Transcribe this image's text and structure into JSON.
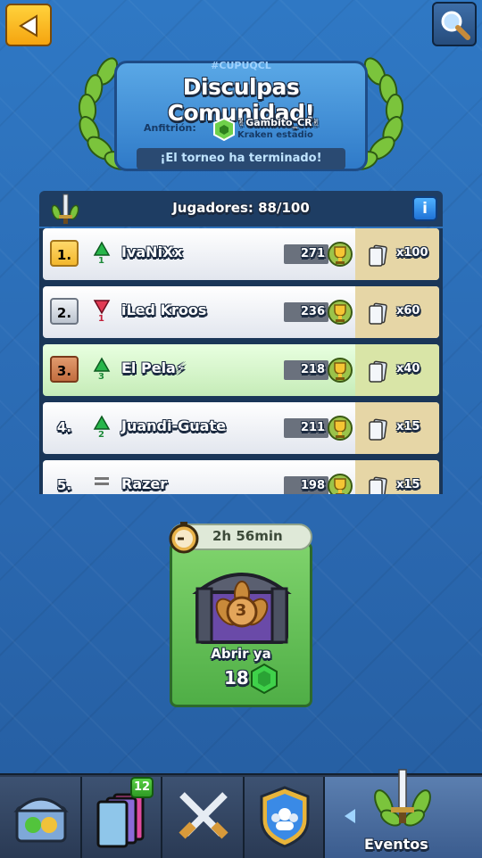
{
  "top": {
    "back_icon": "back-arrow-icon",
    "search_icon": "magnifier-icon"
  },
  "tournament": {
    "tag": "#CUPUQCL",
    "title": "Disculpas Comunidad!",
    "host_label": "Anfitrión:",
    "host_name": "✌Gambito_CR✌",
    "host_clan": "Kraken estadio",
    "status": "¡El torneo ha terminado!"
  },
  "players_panel": {
    "count_label": "Jugadores: 88/100",
    "info_label": "i",
    "rows": [
      {
        "rank": "1.",
        "medal": "gold",
        "trend": "up",
        "trend_num": "1",
        "name": "IvaNiXx",
        "score": "271",
        "reward": "x100",
        "highlight": false
      },
      {
        "rank": "2.",
        "medal": "silver",
        "trend": "down",
        "trend_num": "1",
        "name": "iLed Kroos",
        "score": "236",
        "reward": "x60",
        "highlight": false
      },
      {
        "rank": "3.",
        "medal": "bronze",
        "trend": "up",
        "trend_num": "3",
        "name": "El Pela⚡",
        "score": "218",
        "reward": "x40",
        "highlight": true
      },
      {
        "rank": "4.",
        "medal": "plain",
        "trend": "up",
        "trend_num": "2",
        "name": "Juandi-Guate",
        "score": "211",
        "reward": "x15",
        "highlight": false
      },
      {
        "rank": "5.",
        "medal": "plain",
        "trend": "same",
        "trend_num": "",
        "name": "Razer",
        "score": "198",
        "reward": "x15",
        "highlight": false
      }
    ]
  },
  "chest": {
    "timer": "2h 56min",
    "place": "3",
    "open_label": "Abrir ya",
    "cost": "18"
  },
  "bottom_nav": {
    "tabs": [
      "shop",
      "cards",
      "battle",
      "clan",
      "events"
    ],
    "cards_badge": "12",
    "events_label": "Eventos"
  }
}
